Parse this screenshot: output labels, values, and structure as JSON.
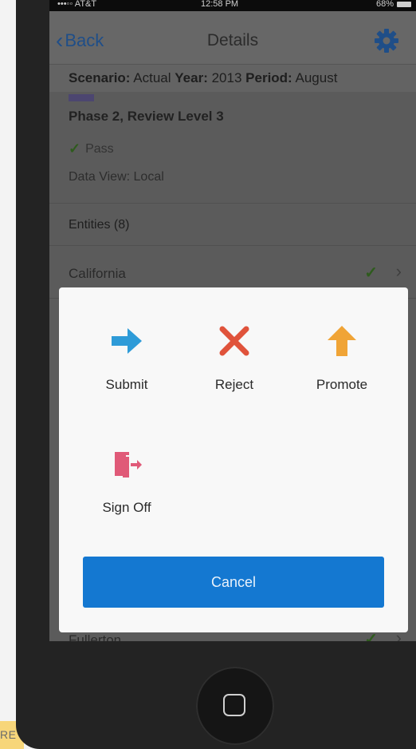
{
  "status": {
    "carrier": "•••◦◦ AT&T",
    "time": "12:58 PM",
    "battery": "68%"
  },
  "nav": {
    "back_label": "Back",
    "title": "Details"
  },
  "scenario": {
    "scenario_key": "Scenario:",
    "scenario_val": "Actual",
    "year_key": "Year:",
    "year_val": "2013",
    "period_key": "Period:",
    "period_val": "August"
  },
  "details": {
    "phase": "Phase 2, Review Level 3",
    "pass": "Pass",
    "data_view": "Data View: Local"
  },
  "entities": {
    "header": "Entities (8)"
  },
  "list": {
    "rows": [
      {
        "label": "California"
      },
      {
        "label": "Fullerton"
      }
    ]
  },
  "modal": {
    "actions": [
      {
        "label": "Submit",
        "icon": "arrow-right-icon"
      },
      {
        "label": "Reject",
        "icon": "x-icon"
      },
      {
        "label": "Promote",
        "icon": "arrow-up-icon"
      },
      {
        "label": "Sign Off",
        "icon": "sign-off-icon"
      }
    ],
    "cancel_label": "Cancel"
  },
  "corner_tag": "RE",
  "colors": {
    "accent_blue": "#1478d1",
    "submit_blue": "#2e9bd8",
    "reject_red": "#e0533b",
    "promote_orange": "#f0a436",
    "signoff_pink": "#e05a78"
  }
}
